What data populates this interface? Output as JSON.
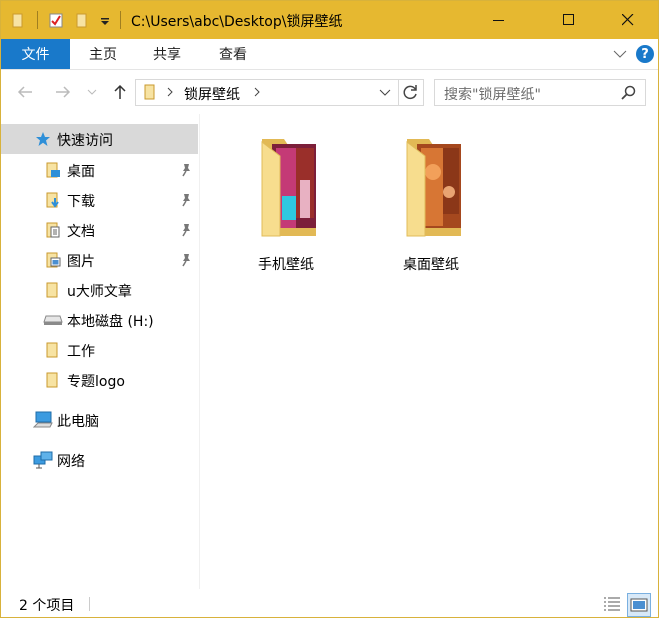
{
  "window": {
    "title": "C:\\Users\\abc\\Desktop\\锁屏壁纸"
  },
  "ribbon": {
    "tabs": [
      "文件",
      "主页",
      "共享",
      "查看"
    ],
    "help": "?"
  },
  "address": {
    "current": "锁屏壁纸",
    "search_placeholder": "搜索\"锁屏壁纸\""
  },
  "sidebar": {
    "quick_access": "快速访问",
    "items": [
      {
        "label": "桌面",
        "pinned": true
      },
      {
        "label": "下载",
        "pinned": true
      },
      {
        "label": "文档",
        "pinned": true
      },
      {
        "label": "图片",
        "pinned": true
      },
      {
        "label": "u大师文章",
        "pinned": false
      },
      {
        "label": "本地磁盘 (H:)",
        "pinned": false
      },
      {
        "label": "工作",
        "pinned": false
      },
      {
        "label": "专题logo",
        "pinned": false
      }
    ],
    "this_pc": "此电脑",
    "network": "网络"
  },
  "content": {
    "items": [
      {
        "label": "手机壁纸"
      },
      {
        "label": "桌面壁纸"
      }
    ]
  },
  "status": {
    "count_text": "2 个项目"
  },
  "colors": {
    "title_bar": "#e6b830",
    "file_tab": "#1979ca",
    "selected": "#d9d9d9",
    "folder": "#f5d37a"
  }
}
